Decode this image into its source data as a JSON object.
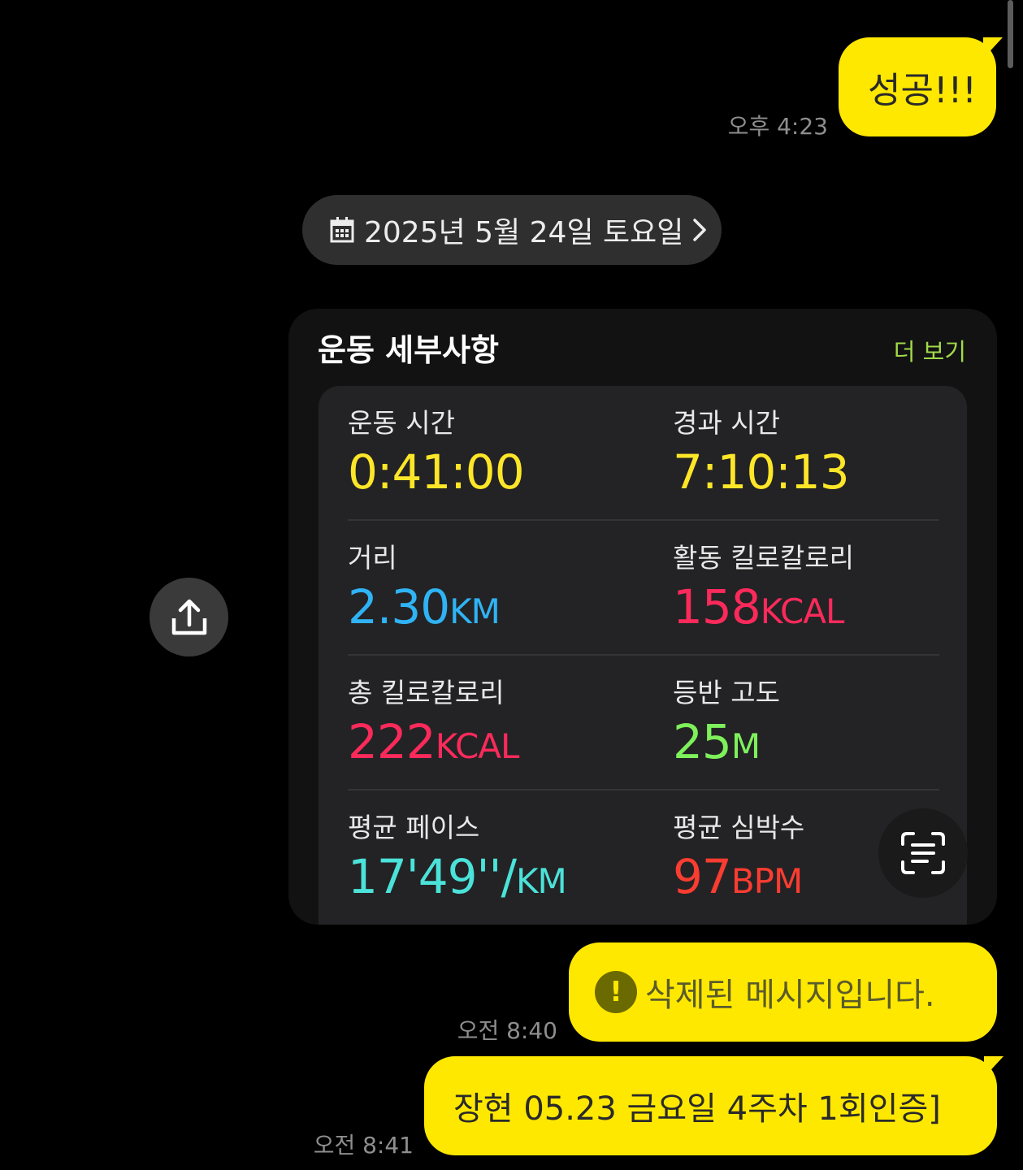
{
  "chat": {
    "messages": [
      {
        "text": "성공!!!",
        "time": "오후 4:23"
      },
      {
        "text": "삭제된 메시지입니다.",
        "time": "오전 8:40"
      },
      {
        "text": "장현 05.23 금요일 4주차 1회인증]",
        "time": "오전 8:41"
      }
    ],
    "date_divider": "2025년 5월 24일 토요일"
  },
  "workout_card": {
    "title": "운동 세부사항",
    "more_label": "더 보기",
    "metrics": [
      {
        "label": "운동 시간",
        "value": "0:41:00",
        "unit": "",
        "color": "#fde628"
      },
      {
        "label": "경과 시간",
        "value": "7:10:13",
        "unit": "",
        "color": "#fde628"
      },
      {
        "label": "거리",
        "value": "2.30",
        "unit": "KM",
        "color": "#2fb3f5"
      },
      {
        "label": "활동 킬로칼로리",
        "value": "158",
        "unit": "KCAL",
        "color": "#fb2a5b"
      },
      {
        "label": "총 킬로칼로리",
        "value": "222",
        "unit": "KCAL",
        "color": "#fb2a5b"
      },
      {
        "label": "등반 고도",
        "value": "25",
        "unit": "M",
        "color": "#7ef05b"
      },
      {
        "label": "평균 페이스",
        "value": "17'49''/",
        "unit": "KM",
        "color": "#4be2d9"
      },
      {
        "label": "평균 심박수",
        "value": "97",
        "unit": "BPM",
        "color": "#fb3c30"
      }
    ]
  },
  "colors": {
    "bubble": "#ffe800",
    "background": "#000000"
  },
  "icons": {
    "date_icon": "calendar-icon",
    "date_chevron": "chevron-right-icon",
    "share": "share-icon",
    "scan": "text-scan-icon",
    "deleted": "exclamation-icon"
  }
}
